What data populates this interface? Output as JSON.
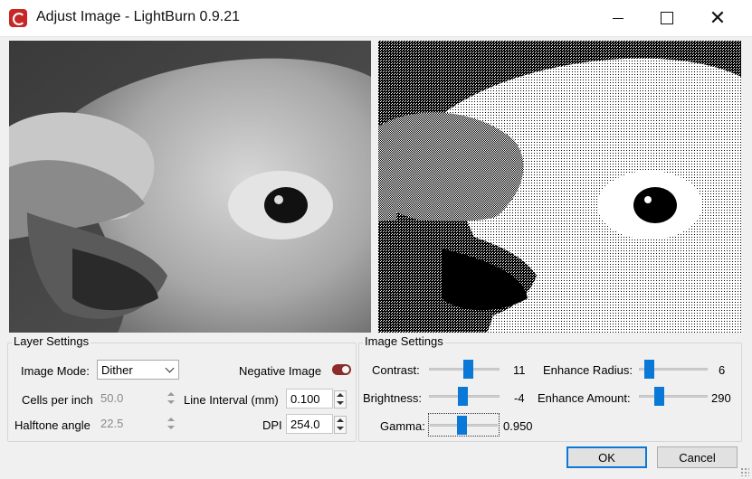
{
  "window": {
    "title": "Adjust Image - LightBurn 0.9.21",
    "buttons": {
      "minimize": "minimize",
      "maximize": "maximize",
      "close": "✕"
    }
  },
  "previews": {
    "original_label": "original-preview",
    "processed_label": "dithered-preview"
  },
  "layer_settings": {
    "title": "Layer Settings",
    "image_mode_label": "Image Mode:",
    "image_mode_value": "Dither",
    "negative_image_label": "Negative Image",
    "negative_image_on": true,
    "cells_per_inch_label": "Cells per inch",
    "cells_per_inch_value": "50.0",
    "halftone_angle_label": "Halftone angle",
    "halftone_angle_value": "22.5",
    "line_interval_label": "Line Interval (mm)",
    "line_interval_value": "0.100",
    "dpi_label": "DPI",
    "dpi_value": "254.0"
  },
  "image_settings": {
    "title": "Image Settings",
    "contrast": {
      "label": "Contrast:",
      "value": "11",
      "position": 0.55
    },
    "brightness": {
      "label": "Brightness:",
      "value": "-4",
      "position": 0.48
    },
    "gamma": {
      "label": "Gamma:",
      "value": "0.950",
      "position": 0.47
    },
    "enhance_radius": {
      "label": "Enhance Radius:",
      "value": "6",
      "position": 0.15
    },
    "enhance_amount": {
      "label": "Enhance Amount:",
      "value": "290",
      "position": 0.29
    }
  },
  "footer": {
    "ok_label": "OK",
    "cancel_label": "Cancel"
  },
  "colors": {
    "accent": "#0a78d7",
    "toggle_on": "#8b2b2b",
    "app_icon": "#c62828"
  }
}
